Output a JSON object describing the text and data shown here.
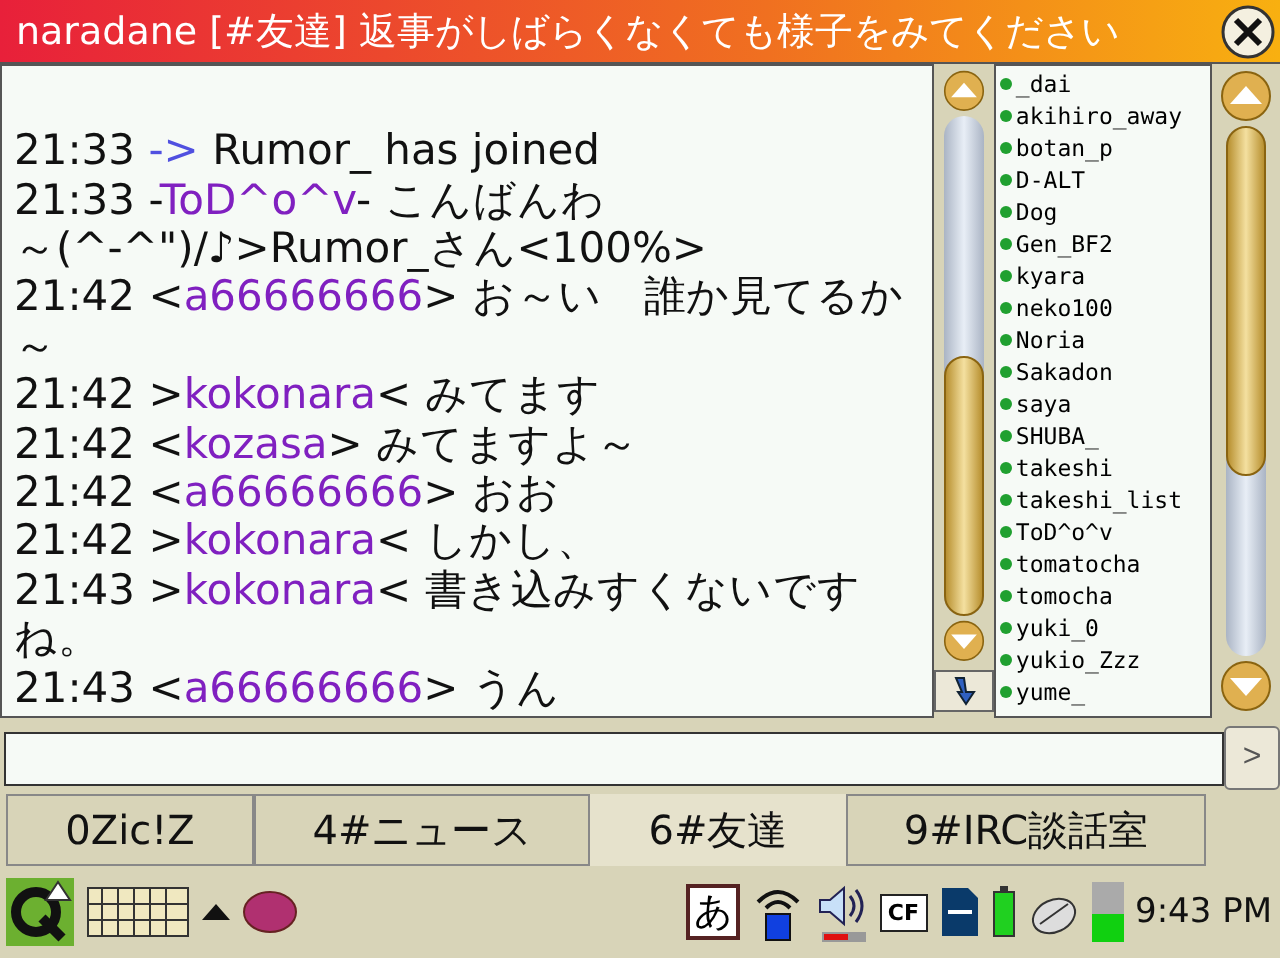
{
  "window": {
    "title": "naradane [#友達] 返事がしばらくなくても様子をみてください"
  },
  "chat": {
    "messages": [
      {
        "kind": "event",
        "time": "21:33",
        "arrow": "->",
        "text": "Rumor_ has joined"
      },
      {
        "kind": "notice",
        "time": "21:33",
        "open": "-",
        "nick": "ToD^o^v",
        "close": "-",
        "text": "こんばんわ"
      },
      {
        "kind": "continuation",
        "text": "～(^-^\")/♪>Rumor_さん<100%>"
      },
      {
        "kind": "msg",
        "time": "21:42",
        "open": "<",
        "nick": "a66666666",
        "close": ">",
        "text": "お～い　誰か見てるか～"
      },
      {
        "kind": "msg",
        "time": "21:42",
        "open": ">",
        "nick": "kokonara",
        "close": "<",
        "text": "みてます"
      },
      {
        "kind": "msg",
        "time": "21:42",
        "open": "<",
        "nick": "kozasa",
        "close": ">",
        "text": "みてますよ～"
      },
      {
        "kind": "msg",
        "time": "21:42",
        "open": "<",
        "nick": "a66666666",
        "close": ">",
        "text": "おお"
      },
      {
        "kind": "msg",
        "time": "21:42",
        "open": ">",
        "nick": "kokonara",
        "close": "<",
        "text": "しかし、"
      },
      {
        "kind": "msg",
        "time": "21:43",
        "open": ">",
        "nick": "kokonara",
        "close": "<",
        "text": "書き込みすくないですね。"
      },
      {
        "kind": "msg",
        "time": "21:43",
        "open": "<",
        "nick": "a66666666",
        "close": ">",
        "text": "うん"
      }
    ]
  },
  "users": [
    "_dai",
    "akihiro_away",
    "botan_p",
    "D-ALT",
    "Dog",
    "Gen_BF2",
    "kyara",
    "neko100",
    "Noria",
    "Sakadon",
    "saya",
    "SHUBA_",
    "takeshi",
    "takeshi_list",
    "ToD^o^v",
    "tomatocha",
    "tomocha",
    "yuki_0",
    "yukio_Zzz",
    "yume_"
  ],
  "input": {
    "send": ">"
  },
  "tabs": [
    {
      "label": "0Zic!Z",
      "selected": false
    },
    {
      "label": "4#ニュース",
      "selected": false
    },
    {
      "label": "6#友達",
      "selected": true
    },
    {
      "label": "9#IRC談話室",
      "selected": false
    }
  ],
  "taskbar": {
    "ime": "あ",
    "cf": "CF",
    "clock": "9:43 PM"
  }
}
